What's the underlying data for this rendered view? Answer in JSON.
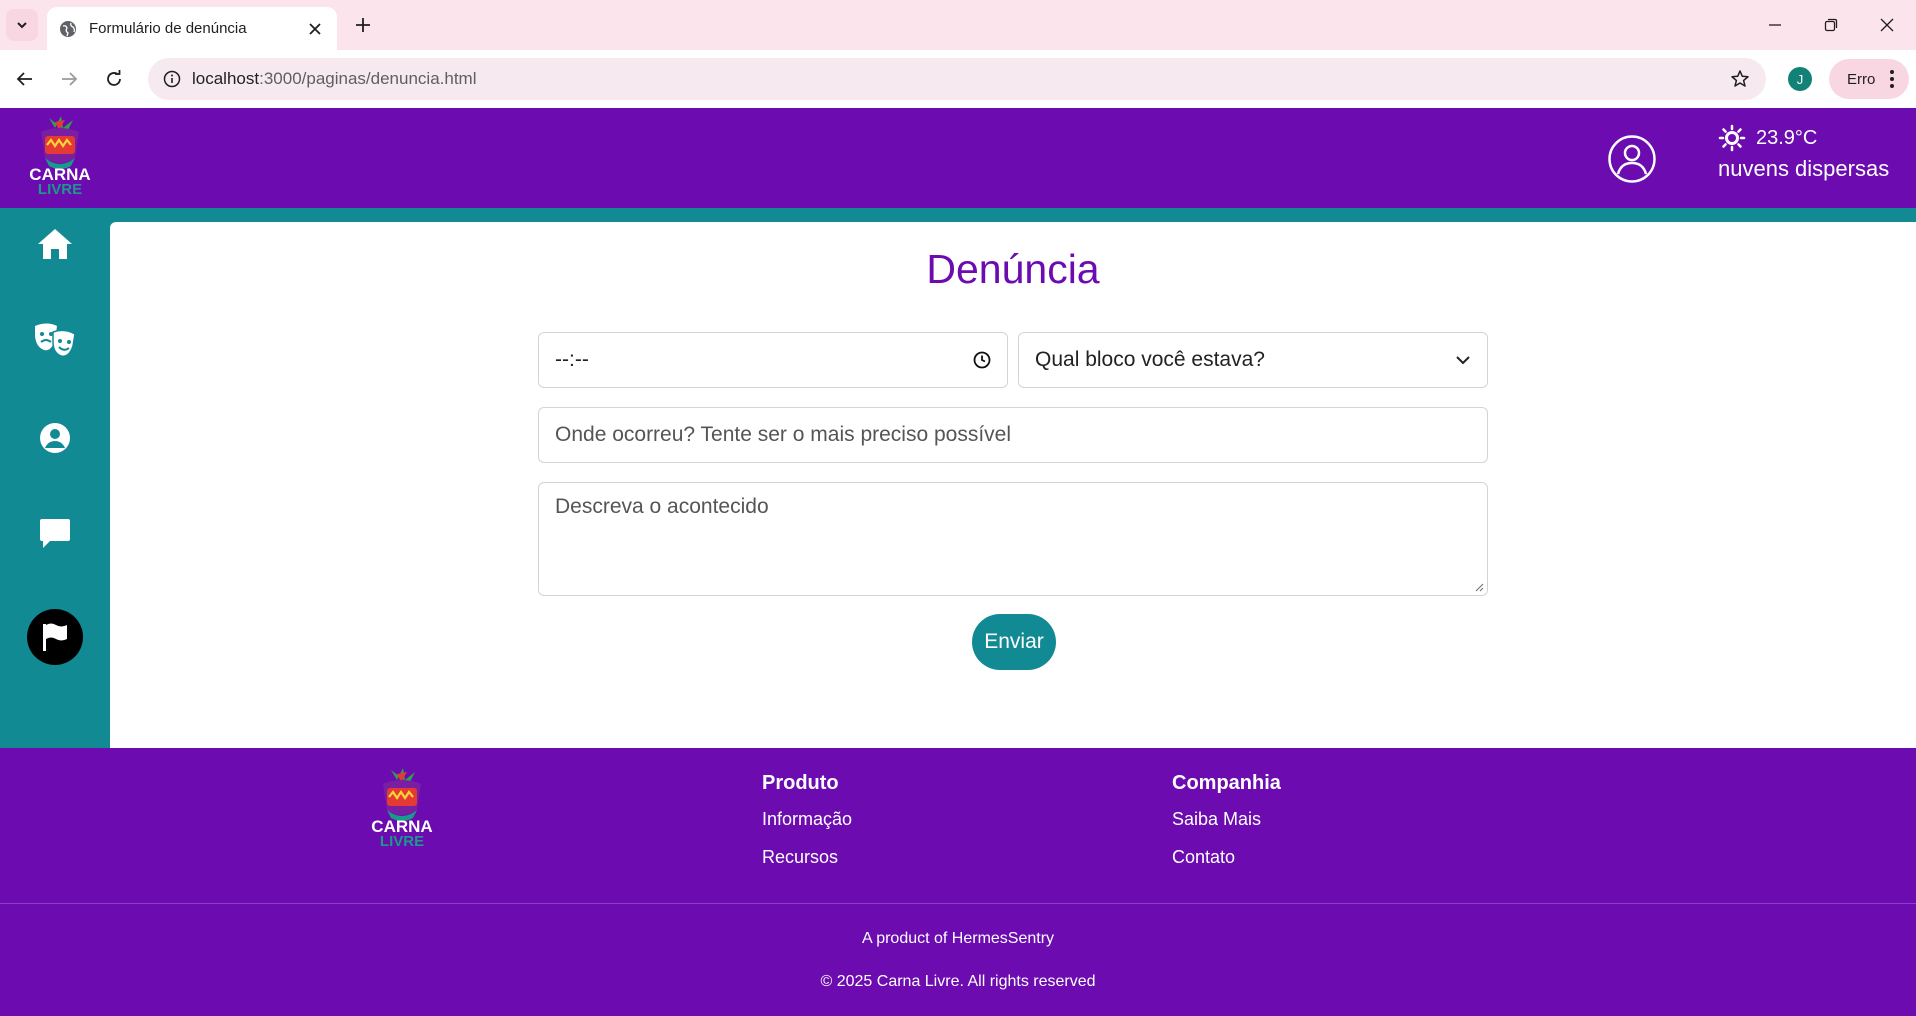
{
  "browser": {
    "tab_title": "Formulário de denúncia",
    "url_host": "localhost",
    "url_path": ":3000/paginas/denuncia.html",
    "profile_initial": "J",
    "profile_status": "Erro"
  },
  "header": {
    "logo_line1": "CARNA",
    "logo_line2": "LIVRE",
    "weather_temp": "23.9°C",
    "weather_desc": "nuvens dispersas"
  },
  "sidebar": {
    "items": [
      {
        "icon": "home-icon"
      },
      {
        "icon": "theater-masks-icon"
      },
      {
        "icon": "user-circle-icon"
      },
      {
        "icon": "comment-icon"
      },
      {
        "icon": "flag-icon",
        "active": true
      }
    ]
  },
  "form": {
    "title": "Denúncia",
    "time_value": "--:--",
    "bloco_placeholder": "Qual bloco você estava?",
    "where_placeholder": "Onde ocorreu? Tente ser o mais preciso possível",
    "description_placeholder": "Descreva o acontecido",
    "submit_label": "Enviar"
  },
  "footer": {
    "logo_line1": "CARNA",
    "logo_line2": "LIVRE",
    "product_title": "Produto",
    "product_links": [
      "Informação",
      "Recursos"
    ],
    "company_title": "Companhia",
    "company_links": [
      "Saiba Mais",
      "Contato"
    ],
    "credit": "A product of HermesSentry",
    "copyright": "© 2025 Carna Livre. All rights reserved"
  },
  "colors": {
    "brand_purple": "#6b0bb0",
    "brand_teal": "#128a94"
  }
}
